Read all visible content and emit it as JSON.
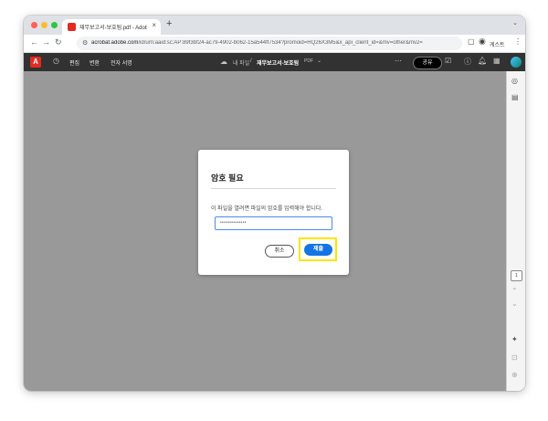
{
  "browser": {
    "tab_title": "재무보고서-보호됨.pdf - Adobe Acrobat",
    "new_tab": "+",
    "tab_close": "×",
    "url_host": "acrobat.adobe.com",
    "url_path": "/id/urn:aaid:sc:AP:89f3bf24-ac79-4902-b062-15a544ff7534?promoid=HQ26X3M5&x_api_client_id=&mv=other&mv2=",
    "profile_name": "게스트"
  },
  "app": {
    "menu": [
      "편집",
      "변환",
      "전자 서명"
    ],
    "breadcrumb_root": "내 파일",
    "breadcrumb_sep": "/",
    "document_name": "재무보고서-보호됨",
    "document_type": "PDF",
    "share_label": "공유",
    "page_number": "1"
  },
  "dialog": {
    "title": "암호 필요",
    "message": "이 파일을 열려면 파일의 암호를 입력해야 합니다.",
    "password_mask": "••••••••••••••",
    "cancel_label": "취소",
    "submit_label": "제출"
  },
  "colors": {
    "accent": "#1473e6",
    "highlight": "#ffe400",
    "app_header": "#323232",
    "canvas": "#999999"
  }
}
